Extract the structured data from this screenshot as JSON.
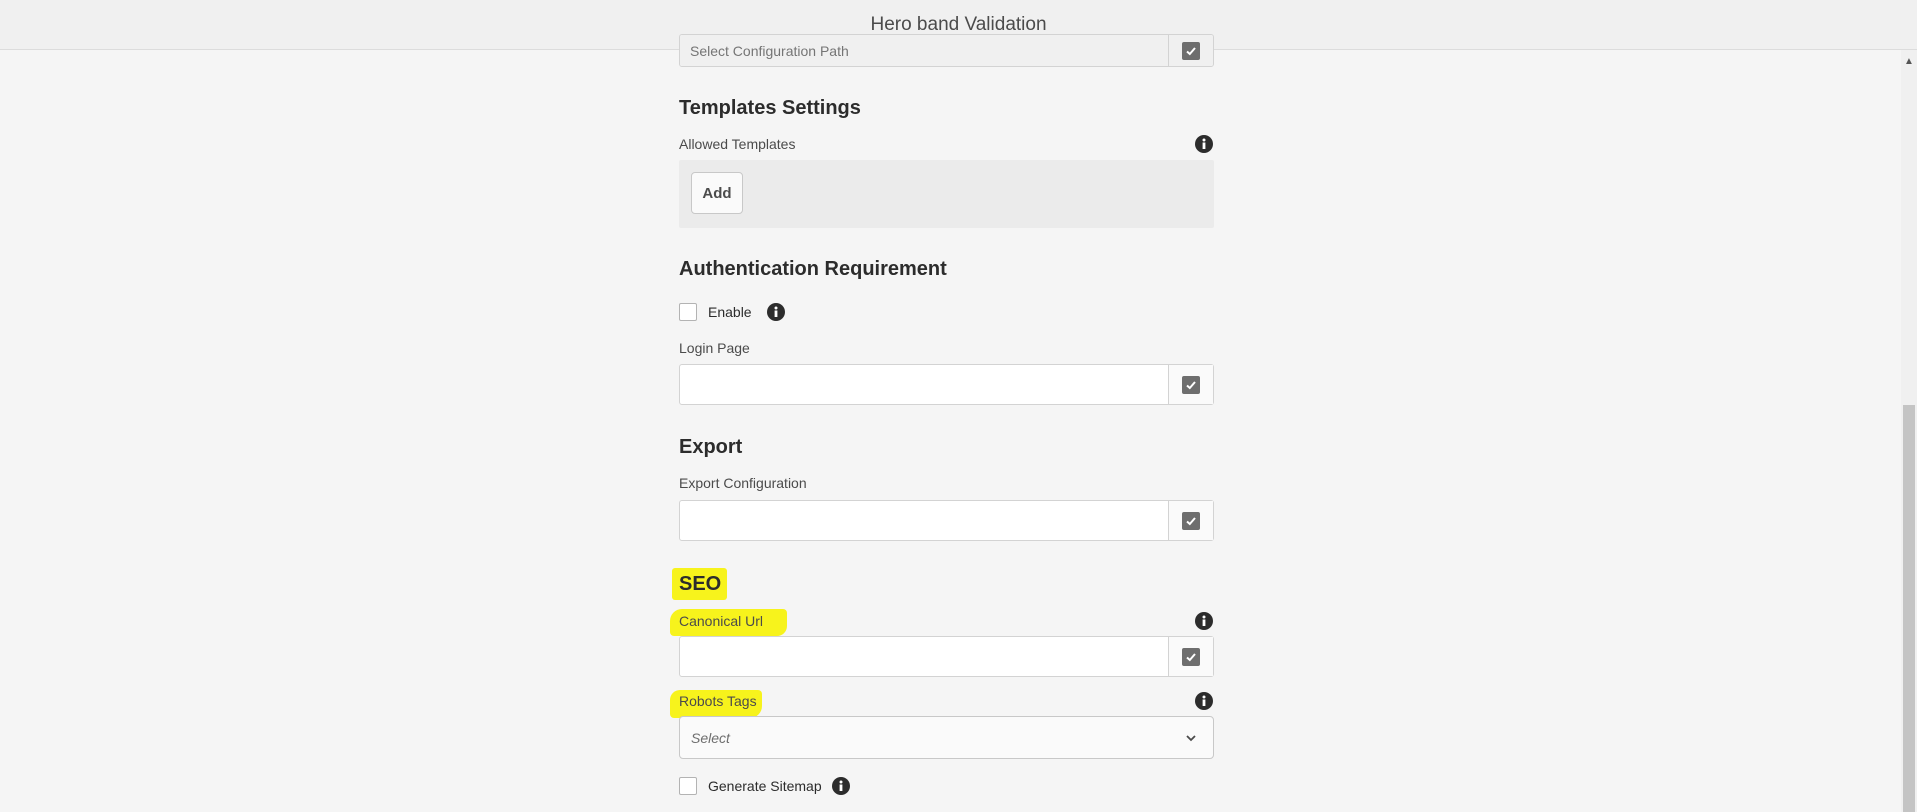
{
  "window": {
    "title": "Hero band Validation"
  },
  "prev_field": {
    "placeholder": "Select Configuration Path"
  },
  "templates": {
    "title": "Templates Settings",
    "allowed_label": "Allowed Templates",
    "add_label": "Add"
  },
  "auth": {
    "title": "Authentication Requirement",
    "enable_label": "Enable",
    "enable_checked": false,
    "login_label": "Login Page",
    "login_value": ""
  },
  "export": {
    "title": "Export",
    "config_label": "Export Configuration",
    "config_value": ""
  },
  "seo": {
    "title": "SEO",
    "canonical_label": "Canonical Url",
    "canonical_value": "",
    "robots_label": "Robots Tags",
    "robots_selected": "Select",
    "sitemap_label": "Generate Sitemap",
    "sitemap_checked": false
  },
  "colors": {
    "highlight": "#f7f31c",
    "background": "#f5f5f5"
  },
  "icons": [
    "info-icon",
    "checkmark-icon",
    "chevron-down-icon",
    "scroll-up-arrow-icon"
  ]
}
